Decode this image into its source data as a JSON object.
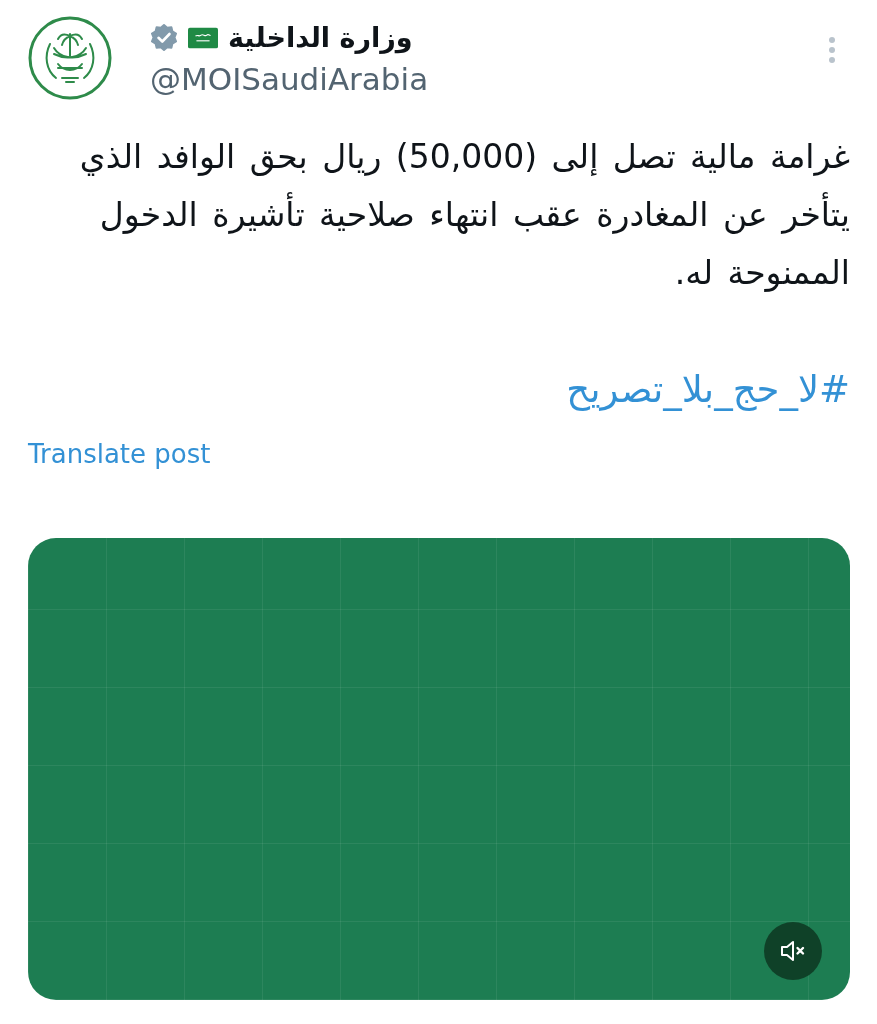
{
  "post": {
    "author": {
      "name": "وزارة الداخلية",
      "handle": "@MOISaudiArabia",
      "verified": true
    },
    "text": "غرامة مالية تصل إلى (50,000) ريال بحق الوافد الذي يتأخر عن المغادرة عقب انتهاء صلاحية تأشيرة الدخول الممنوحة له.",
    "hashtag": "#لا_حج_بلا_تصريح",
    "translate_link": "Translate post",
    "video": {
      "muted": true
    }
  }
}
